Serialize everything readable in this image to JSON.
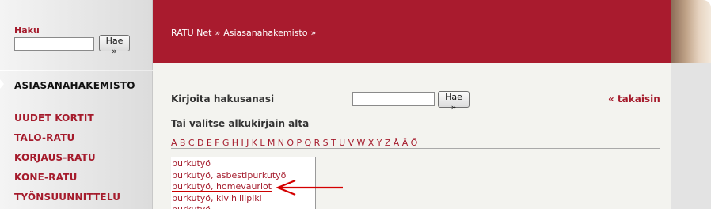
{
  "sidebar": {
    "search_label": "Haku",
    "search_value": "",
    "search_button": "Hae »",
    "active_item": "ASIASANAHAKEMISTO",
    "items": [
      {
        "label": "UUDET KORTIT"
      },
      {
        "label": "TALO-RATU"
      },
      {
        "label": "KORJAUS-RATU"
      },
      {
        "label": "KONE-RATU"
      },
      {
        "label": "TYÖNSUUNNITTELU"
      }
    ]
  },
  "header": {
    "breadcrumb": [
      "RATU Net",
      "Asiasanahakemisto"
    ],
    "separator": "»",
    "brand_color": "#a91b2e"
  },
  "main": {
    "prompt_label": "Kirjoita hakusanasi",
    "search_value": "",
    "search_button": "Hae »",
    "back_link": "« takaisin",
    "alpha_label": "Tai valitse alkukirjain alta",
    "letters": [
      "A",
      "B",
      "C",
      "D",
      "E",
      "F",
      "G",
      "H",
      "I",
      "J",
      "K",
      "L",
      "M",
      "N",
      "O",
      "P",
      "Q",
      "R",
      "S",
      "T",
      "U",
      "V",
      "W",
      "X",
      "Y",
      "Z",
      "Å",
      "Ä",
      "Ö"
    ],
    "results": [
      {
        "label": "purkutyö"
      },
      {
        "label": "purkutyö, asbestipurkutyö"
      },
      {
        "label": "purkutyö, homevauriot"
      },
      {
        "label": "purkutyö, kivihiilipiki"
      },
      {
        "label": "purkutyö, ..."
      }
    ],
    "highlighted_result_index": 2,
    "annotation": {
      "icon": "red-arrow-left-icon",
      "color": "#d40000"
    }
  }
}
